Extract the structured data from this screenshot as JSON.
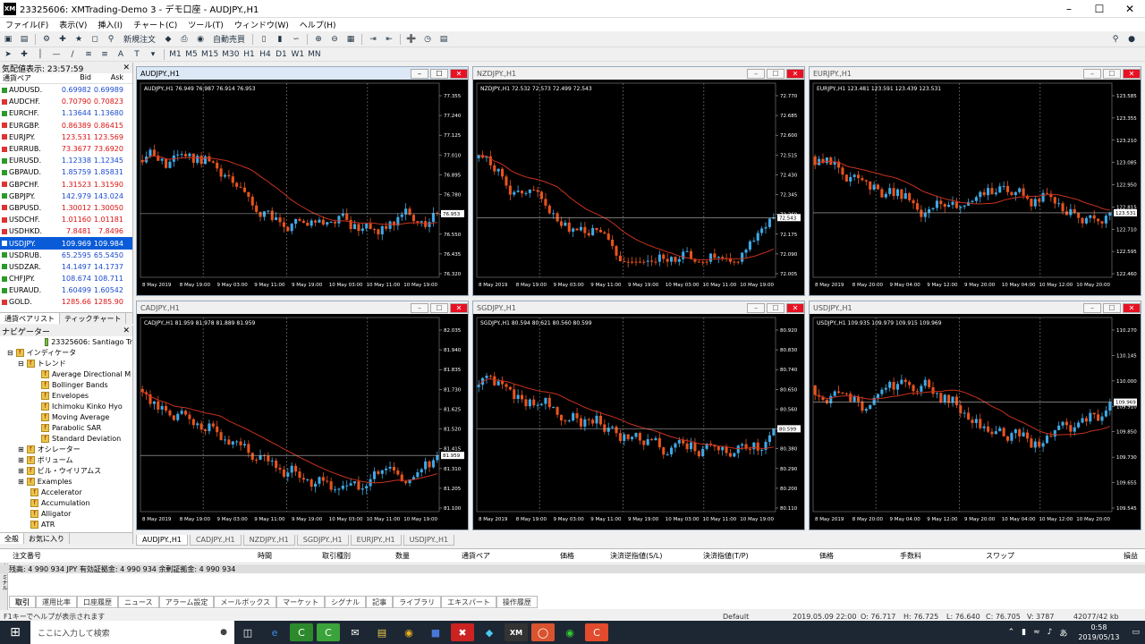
{
  "window": {
    "title": "23325606: XMTrading-Demo 3 - デモ口座 - AUDJPY.,H1",
    "logo": "XM"
  },
  "menu": [
    "ファイル(F)",
    "表示(V)",
    "挿入(I)",
    "チャート(C)",
    "ツール(T)",
    "ウィンドウ(W)",
    "ヘルプ(H)"
  ],
  "toolbar": {
    "new_order": "新規注文",
    "auto_trade": "自動売買",
    "timeframes": [
      "M1",
      "M5",
      "M15",
      "M30",
      "H1",
      "H4",
      "D1",
      "W1",
      "MN"
    ]
  },
  "market_watch": {
    "header": "気配値表示: 23:57:59",
    "col_symbol": "通貨ペア",
    "col_bid": "Bid",
    "col_ask": "Ask",
    "rows": [
      {
        "sym": "AUDUSD.",
        "bid": "0.69982",
        "ask": "0.69989",
        "dir": "up"
      },
      {
        "sym": "AUDCHF.",
        "bid": "0.70790",
        "ask": "0.70823",
        "dir": "dn"
      },
      {
        "sym": "EURCHF.",
        "bid": "1.13644",
        "ask": "1.13680",
        "dir": "up"
      },
      {
        "sym": "EURGBP.",
        "bid": "0.86389",
        "ask": "0.86415",
        "dir": "dn"
      },
      {
        "sym": "EURJPY.",
        "bid": "123.531",
        "ask": "123.569",
        "dir": "dn"
      },
      {
        "sym": "EURRUB.",
        "bid": "73.3677",
        "ask": "73.6920",
        "dir": "dn"
      },
      {
        "sym": "EURUSD.",
        "bid": "1.12338",
        "ask": "1.12345",
        "dir": "up"
      },
      {
        "sym": "GBPAUD.",
        "bid": "1.85759",
        "ask": "1.85831",
        "dir": "up"
      },
      {
        "sym": "GBPCHF.",
        "bid": "1.31523",
        "ask": "1.31590",
        "dir": "dn"
      },
      {
        "sym": "GBPJPY.",
        "bid": "142.979",
        "ask": "143.024",
        "dir": "up"
      },
      {
        "sym": "GBPUSD.",
        "bid": "1.30012",
        "ask": "1.30050",
        "dir": "dn"
      },
      {
        "sym": "USDCHF.",
        "bid": "1.01160",
        "ask": "1.01181",
        "dir": "dn"
      },
      {
        "sym": "USDHKD.",
        "bid": "7.8481",
        "ask": "7.8496",
        "dir": "dn"
      },
      {
        "sym": "USDJPY.",
        "bid": "109.969",
        "ask": "109.984",
        "dir": "sel"
      },
      {
        "sym": "USDRUB.",
        "bid": "65.2595",
        "ask": "65.5450",
        "dir": "up"
      },
      {
        "sym": "USDZAR.",
        "bid": "14.1497",
        "ask": "14.1737",
        "dir": "up"
      },
      {
        "sym": "CHFJPY.",
        "bid": "108.674",
        "ask": "108.711",
        "dir": "up"
      },
      {
        "sym": "EURAUD.",
        "bid": "1.60499",
        "ask": "1.60542",
        "dir": "up"
      },
      {
        "sym": "GOLD.",
        "bid": "1285.66",
        "ask": "1285.90",
        "dir": "dn"
      }
    ],
    "tabs": [
      "通貨ペアリスト",
      "ティックチャート"
    ]
  },
  "navigator": {
    "header": "ナビゲーター",
    "account": "23325606: Santiago Tr",
    "indicators": "インディケータ",
    "trend": "トレンド",
    "trend_items": [
      "Average Directional M",
      "Bollinger Bands",
      "Envelopes",
      "Ichimoku Kinko Hyo",
      "Moving Average",
      "Parabolic SAR",
      "Standard Deviation"
    ],
    "groups": [
      "オシレーター",
      "ボリューム",
      "ビル・ウイリアムス",
      "Examples"
    ],
    "examples": [
      "Accelerator",
      "Accumulation",
      "Alligator",
      "ATR"
    ],
    "tabs": [
      "全般",
      "お気に入り"
    ]
  },
  "charts": [
    {
      "title": "AUDJPY.,H1",
      "info": "AUDJPY.,H1  76.949 76.987 76.914 76.953",
      "price": "76.953",
      "scale": [
        "77.355",
        "77.240",
        "77.125",
        "77.010",
        "76.895",
        "76.780",
        "76.665",
        "76.550",
        "76.435",
        "76.320"
      ],
      "times": [
        "8 May 2019",
        "8 May 19:00",
        "9 May 03:00",
        "9 May 11:00",
        "9 May 19:00",
        "10 May 03:00",
        "10 May 11:00",
        "10 May 19:00"
      ]
    },
    {
      "title": "NZDJPY.,H1",
      "info": "NZDJPY.,H1  72.532 72.573 72.499 72.543",
      "price": "72.543",
      "scale": [
        "72.770",
        "72.685",
        "72.600",
        "72.515",
        "72.430",
        "72.345",
        "72.260",
        "72.175",
        "72.090",
        "72.005"
      ],
      "times": [
        "8 May 2019",
        "8 May 19:00",
        "9 May 03:00",
        "9 May 11:00",
        "9 May 19:00",
        "10 May 03:00",
        "10 May 11:00",
        "10 May 19:00"
      ]
    },
    {
      "title": "EURJPY.,H1",
      "info": "EURJPY.,H1  123.481 123.591 123.439 123.531",
      "price": "123.531",
      "scale": [
        "123.585",
        "123.355",
        "123.210",
        "123.085",
        "122.950",
        "122.815",
        "122.710",
        "122.595",
        "122.460"
      ],
      "times": [
        "8 May 2019",
        "8 May 20:00",
        "9 May 04:00",
        "9 May 12:00",
        "9 May 20:00",
        "10 May 04:00",
        "10 May 12:00",
        "10 May 20:00"
      ]
    },
    {
      "title": "CADJPY.,H1",
      "info": "CADJPY.,H1  81.959 81.978 81.889 81.959",
      "price": "81.959",
      "scale": [
        "82.035",
        "81.940",
        "81.835",
        "81.730",
        "81.625",
        "81.520",
        "81.415",
        "81.310",
        "81.205",
        "81.100"
      ],
      "times": [
        "8 May 2019",
        "8 May 19:00",
        "9 May 03:00",
        "9 May 11:00",
        "9 May 19:00",
        "10 May 03:00",
        "10 May 11:00",
        "10 May 19:00"
      ]
    },
    {
      "title": "SGDJPY.,H1",
      "info": "SGDJPY.,H1  80.594 80.621 80.560 80.599",
      "price": "80.599",
      "scale": [
        "80.920",
        "80.830",
        "80.740",
        "80.650",
        "80.560",
        "80.470",
        "80.380",
        "80.290",
        "80.200",
        "80.110"
      ],
      "times": [
        "8 May 2019",
        "8 May 19:00",
        "9 May 03:00",
        "9 May 11:00",
        "9 May 19:00",
        "10 May 03:00",
        "10 May 11:00",
        "10 May 19:00"
      ]
    },
    {
      "title": "USDJPY.,H1",
      "info": "USDJPY.,H1  109.935 109.979 109.915 109.969",
      "price": "109.969",
      "scale": [
        "110.270",
        "110.145",
        "110.000",
        "109.910",
        "109.850",
        "109.730",
        "109.655",
        "109.545"
      ],
      "times": [
        "8 May 2019",
        "8 May 20:00",
        "9 May 04:00",
        "9 May 12:00",
        "9 May 20:00",
        "10 May 04:00",
        "10 May 12:00",
        "10 May 20:00"
      ]
    }
  ],
  "chart_tabs": [
    "AUDJPY.,H1",
    "CADJPY.,H1",
    "NZDJPY.,H1",
    "SGDJPY.,H1",
    "EURJPY.,H1",
    "USDJPY.,H1"
  ],
  "terminal": {
    "cols": [
      "注文番号",
      "時間",
      "取引種別",
      "数量",
      "通貨ペア",
      "価格",
      "決済逆指値(S/L)",
      "決済指値(T/P)",
      "価格",
      "手数料",
      "スワップ",
      "損益"
    ],
    "balance": "残高: 4 990 934 JPY  有効証拠金: 4 990 934  余剰証拠金: 4 990 934",
    "tabs": [
      "取引",
      "運用比率",
      "口座履歴",
      "ニュース",
      "アラーム設定",
      "メールボックス",
      "マーケット",
      "シグナル",
      "記事",
      "ライブラリ",
      "エキスパート",
      "操作履歴"
    ],
    "side_label": "ターミナル"
  },
  "status": {
    "help": "F1キーでヘルプが表示されます",
    "profile": "Default",
    "datetime": "2019.05.09 22:00",
    "o": "O: 76.717",
    "h": "H: 76.725",
    "l": "L: 76.640",
    "c": "C: 76.705",
    "v": "V: 3787",
    "kb": "42077/42 kb"
  },
  "taskbar": {
    "search": "ここに入力して検索",
    "time": "0:58",
    "date": "2019/05/13",
    "ime": "あ"
  },
  "colors": {
    "bull": "#3fa9e6",
    "bear": "#e8541e",
    "ma": "#c8321e",
    "bg": "#000000"
  }
}
